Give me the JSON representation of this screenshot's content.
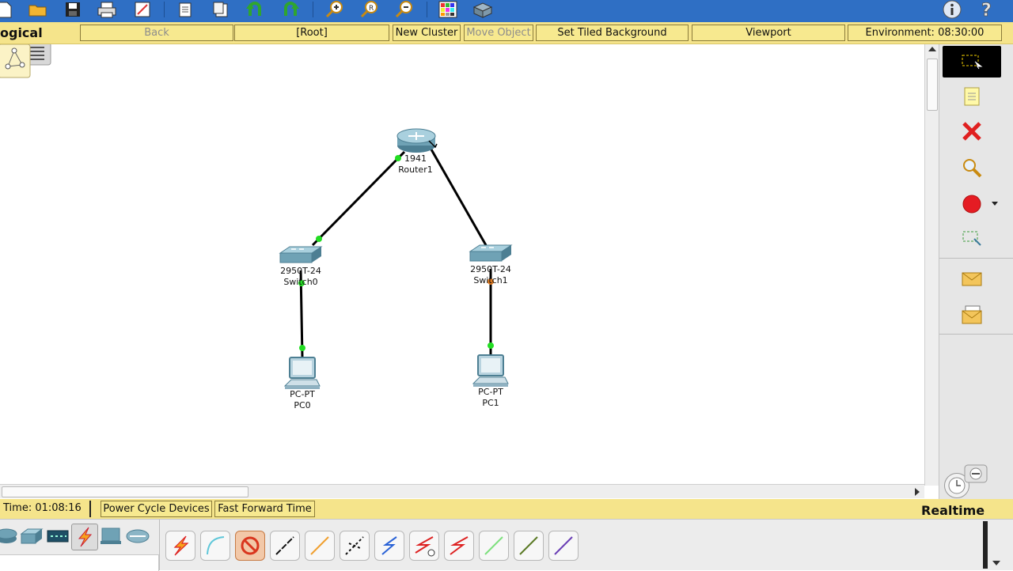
{
  "header": {
    "mode_label": "ogical",
    "back_label": "Back",
    "root_label": "[Root]",
    "new_cluster_label": "New Cluster",
    "move_object_label": "Move Object",
    "tiled_bg_label": "Set Tiled Background",
    "viewport_label": "Viewport",
    "environment_label": "Environment: 08:30:00"
  },
  "toolbar_icons": [
    "new-file-icon",
    "open-folder-icon",
    "save-icon",
    "print-icon",
    "activity-wizard-icon",
    "copy-icon",
    "paste-icon",
    "undo-icon",
    "redo-icon",
    "zoom-in-icon",
    "zoom-reset-icon",
    "zoom-out-icon",
    "palette-icon",
    "custom-device-icon",
    "info-icon",
    "help-icon"
  ],
  "topology": {
    "devices": [
      {
        "model": "1941",
        "name": "Router1",
        "type": "router"
      },
      {
        "model": "2950T-24",
        "name": "Switch0",
        "type": "switch"
      },
      {
        "model": "2950T-24",
        "name": "Switch1",
        "type": "switch"
      },
      {
        "model": "PC-PT",
        "name": "PC0",
        "type": "pc"
      },
      {
        "model": "PC-PT",
        "name": "PC1",
        "type": "pc"
      }
    ],
    "links": [
      {
        "from": "Router1",
        "to": "Switch0"
      },
      {
        "from": "Router1",
        "to": "Switch1"
      },
      {
        "from": "Switch0",
        "to": "PC0"
      },
      {
        "from": "Switch1",
        "to": "PC1"
      }
    ],
    "link_up_color": "#22dd22",
    "link_wait_color": "#e07a1f"
  },
  "right_tools": [
    "select-icon",
    "note-icon",
    "delete-icon",
    "inspect-icon",
    "draw-ellipse-icon",
    "resize-icon",
    "add-simple-pdu-icon",
    "add-complex-pdu-icon"
  ],
  "status": {
    "time_label": "Time: 01:08:16",
    "power_cycle_label": "Power Cycle Devices",
    "fast_forward_label": "Fast Forward Time",
    "mode": "Realtime"
  },
  "tray": {
    "categories": [
      "routers-category-icon",
      "switches-category-icon",
      "hubs-category-icon",
      "connections-category-icon",
      "end-devices-category-icon",
      "wan-emulation-category-icon"
    ],
    "connections": [
      "auto-connection-icon",
      "console-cable-icon",
      "no-connection-icon",
      "copper-straight-icon",
      "copper-cross-icon",
      "fiber-icon",
      "phone-cable-icon",
      "coaxial-icon",
      "serial-dce-icon",
      "serial-dte-icon",
      "octal-cable-icon",
      "iot-cable-icon",
      "usb-cable-icon"
    ]
  },
  "colors": {
    "toolbar_blue": "#2f6fc4",
    "bar_yellow": "#f5e48b",
    "accent_red": "#e02020"
  }
}
